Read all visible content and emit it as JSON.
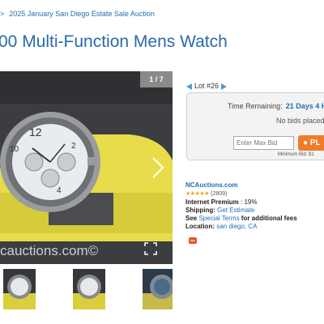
{
  "breadcrumb": {
    "separator": ">",
    "current": "2025 January San Diego Estate Sale Auction"
  },
  "title": "00 Multi-Function Mens Watch",
  "gallery": {
    "counter": "1 / 7",
    "watermark": "cauctions.com©"
  },
  "lot": {
    "label": "Lot #26"
  },
  "bidding": {
    "time_label": "Time Remaining:",
    "time_value": "21 Days 4 H",
    "no_bids": "No bids placed",
    "max_bid_placeholder": "Enter Max Bid",
    "place_label": "PL",
    "min_bid": "Minimum Bid: $1"
  },
  "seller": {
    "site": "NCAuctions.com",
    "stars": "★★★★★",
    "rating": "(2809)",
    "premium_label": "Internet Premium",
    "premium_value": ": 19%",
    "shipping_label": "Shipping:",
    "shipping_link": "Get Estimate",
    "terms_prefix": "See",
    "terms_link": "Special Terms",
    "terms_suffix": "for additional fees",
    "location_label": "Location:",
    "location_value": "san diego, CA",
    "badge": "app"
  },
  "colors": {
    "accent": "#2a6aa9",
    "link": "#1f6fb5",
    "place_bid": "#f07b2a",
    "stars": "#e8a317"
  }
}
